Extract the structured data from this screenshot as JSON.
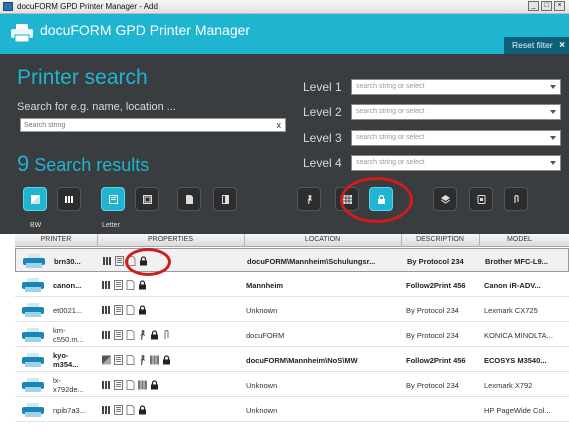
{
  "window": {
    "title": "docuFORM GPD Printer Manager - Add",
    "controls": [
      "_",
      "□",
      "×"
    ]
  },
  "header": {
    "app_name": "docuFORM GPD Printer Manager",
    "reset_label": "Reset filter",
    "reset_icon": "×"
  },
  "search": {
    "title": "Printer search",
    "hint": "Search for e.g. name, location ...",
    "input_placeholder": "Search string",
    "clear_icon": "x",
    "results_count": "9",
    "results_label": " Search results"
  },
  "levels": [
    {
      "label": "Level 1",
      "placeholder": "search string or select"
    },
    {
      "label": "Level 2",
      "placeholder": "search string or select"
    },
    {
      "label": "Level 3",
      "placeholder": "search string or select"
    },
    {
      "label": "Level 4",
      "placeholder": "search string or select"
    }
  ],
  "filters": [
    {
      "icon": "color-icon",
      "active": true,
      "caption": "BW"
    },
    {
      "icon": "duplex-icon",
      "active": false,
      "caption": ""
    },
    {
      "icon": "paper-letter-icon",
      "active": true,
      "caption": "Letter"
    },
    {
      "icon": "stapler-icon",
      "active": false,
      "caption": ""
    },
    {
      "icon": "document-icon",
      "active": false,
      "caption": ""
    },
    {
      "icon": "book-icon",
      "active": false,
      "caption": ""
    },
    {
      "icon": "follow-me-icon",
      "active": false,
      "caption": ""
    },
    {
      "icon": "grid-icon",
      "active": false,
      "caption": ""
    },
    {
      "icon": "lock-icon",
      "active": true,
      "caption": ""
    },
    {
      "icon": "layers-icon",
      "active": false,
      "caption": ""
    },
    {
      "icon": "badge-icon",
      "active": false,
      "caption": ""
    },
    {
      "icon": "paperclip-icon",
      "active": false,
      "caption": ""
    }
  ],
  "table": {
    "columns": [
      "PRINTER",
      "PROPERTIES",
      "LOCATION",
      "DESCRIPTION",
      "MODEL"
    ],
    "rows": [
      {
        "name": "brn30...",
        "location": "docuFORM\\Mannheim\\Schulungsr...",
        "description": "By Protocol 234",
        "model": "Brother MFC-L9...",
        "bold": true,
        "selected": true,
        "props": [
          "duplex-icon",
          "paper-letter-icon",
          "document-icon",
          "lock-icon"
        ]
      },
      {
        "name": "canon...",
        "location": "Mannheim",
        "description": "Follow2Print 456",
        "model": "Canon iR-ADV...",
        "bold": true,
        "selected": false,
        "props": [
          "duplex-icon",
          "paper-letter-icon",
          "document-icon",
          "lock-icon"
        ]
      },
      {
        "name": "et0021...",
        "location": "Unknown",
        "description": "By Protocol 234",
        "model": "Lexmark CX725",
        "bold": false,
        "selected": false,
        "props": [
          "duplex-icon",
          "paper-letter-icon",
          "document-icon",
          "lock-icon"
        ]
      },
      {
        "name": "km-\nc550.m...",
        "location": "docuFORM",
        "description": "By Protocol 234",
        "model": "KONICA MINOLTA...",
        "bold": false,
        "selected": false,
        "props": [
          "duplex-icon",
          "paper-letter-icon",
          "document-icon",
          "follow-me-icon",
          "lock-icon",
          "paperclip-icon"
        ]
      },
      {
        "name": "kyo-\nm354...",
        "location": "docuFORM\\Mannheim\\NoS\\MW",
        "description": "Follow2Print 456",
        "model": "ECOSYS M3540...",
        "bold": true,
        "selected": false,
        "props": [
          "color-icon",
          "paper-letter-icon",
          "document-icon",
          "follow-me-icon",
          "grid-icon",
          "lock-icon"
        ]
      },
      {
        "name": "lx-\nx792de...",
        "location": "Unknown",
        "description": "By Protocol 234",
        "model": "Lexmark X792",
        "bold": false,
        "selected": false,
        "props": [
          "duplex-icon",
          "paper-letter-icon",
          "document-icon",
          "grid-icon",
          "lock-icon"
        ]
      },
      {
        "name": "npib7a3...",
        "location": "Unknown",
        "description": "",
        "model": "HP PageWide Col...",
        "bold": false,
        "selected": false,
        "props": [
          "duplex-icon",
          "paper-letter-icon",
          "document-icon",
          "lock-icon"
        ]
      }
    ]
  },
  "colors": {
    "accent": "#1fb5d0",
    "panel": "#3a3d40",
    "highlight": "#d11c1c"
  }
}
